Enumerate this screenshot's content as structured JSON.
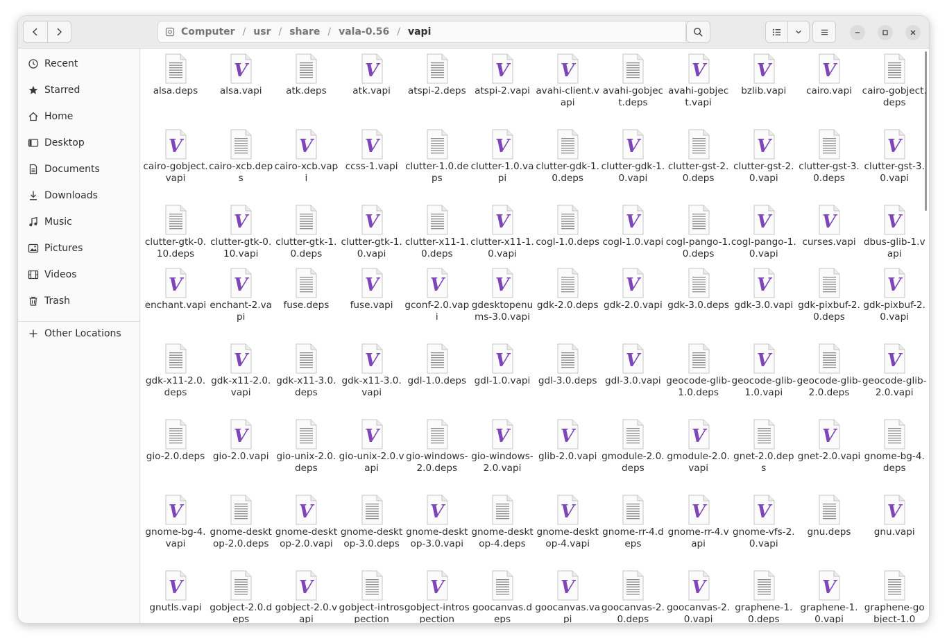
{
  "path": [
    "Computer",
    "usr",
    "share",
    "vala-0.56",
    "vapi"
  ],
  "sidebar": {
    "items": [
      {
        "label": "Recent",
        "icon": "clock-icon"
      },
      {
        "label": "Starred",
        "icon": "star-icon"
      },
      {
        "label": "Home",
        "icon": "home-icon"
      },
      {
        "label": "Desktop",
        "icon": "desktop-icon"
      },
      {
        "label": "Documents",
        "icon": "document-icon"
      },
      {
        "label": "Downloads",
        "icon": "download-icon"
      },
      {
        "label": "Music",
        "icon": "music-icon"
      },
      {
        "label": "Pictures",
        "icon": "picture-icon"
      },
      {
        "label": "Videos",
        "icon": "video-icon"
      },
      {
        "label": "Trash",
        "icon": "trash-icon"
      }
    ],
    "other_locations": "Other Locations"
  },
  "colors": {
    "vapi_accent": "#7e45b8",
    "doc_lines": "#8a8a8a"
  },
  "files": [
    {
      "name": "alsa.deps",
      "type": "deps"
    },
    {
      "name": "alsa.vapi",
      "type": "vapi"
    },
    {
      "name": "atk.deps",
      "type": "deps"
    },
    {
      "name": "atk.vapi",
      "type": "vapi"
    },
    {
      "name": "atspi-2.deps",
      "type": "deps"
    },
    {
      "name": "atspi-2.vapi",
      "type": "vapi"
    },
    {
      "name": "avahi-client.vapi",
      "type": "vapi"
    },
    {
      "name": "avahi-gobject.deps",
      "type": "deps"
    },
    {
      "name": "avahi-gobject.vapi",
      "type": "vapi"
    },
    {
      "name": "bzlib.vapi",
      "type": "vapi"
    },
    {
      "name": "cairo.vapi",
      "type": "vapi"
    },
    {
      "name": "cairo-gobject.deps",
      "type": "deps"
    },
    {
      "name": "cairo-gobject.vapi",
      "type": "vapi"
    },
    {
      "name": "cairo-xcb.deps",
      "type": "deps"
    },
    {
      "name": "cairo-xcb.vapi",
      "type": "vapi"
    },
    {
      "name": "ccss-1.vapi",
      "type": "vapi"
    },
    {
      "name": "clutter-1.0.deps",
      "type": "deps"
    },
    {
      "name": "clutter-1.0.vapi",
      "type": "vapi"
    },
    {
      "name": "clutter-gdk-1.0.deps",
      "type": "deps"
    },
    {
      "name": "clutter-gdk-1.0.vapi",
      "type": "vapi"
    },
    {
      "name": "clutter-gst-2.0.deps",
      "type": "deps"
    },
    {
      "name": "clutter-gst-2.0.vapi",
      "type": "vapi"
    },
    {
      "name": "clutter-gst-3.0.deps",
      "type": "deps"
    },
    {
      "name": "clutter-gst-3.0.vapi",
      "type": "vapi"
    },
    {
      "name": "clutter-gtk-0.10.deps",
      "type": "deps"
    },
    {
      "name": "clutter-gtk-0.10.vapi",
      "type": "vapi"
    },
    {
      "name": "clutter-gtk-1.0.deps",
      "type": "deps"
    },
    {
      "name": "clutter-gtk-1.0.vapi",
      "type": "vapi"
    },
    {
      "name": "clutter-x11-1.0.deps",
      "type": "deps"
    },
    {
      "name": "clutter-x11-1.0.vapi",
      "type": "vapi"
    },
    {
      "name": "cogl-1.0.deps",
      "type": "deps"
    },
    {
      "name": "cogl-1.0.vapi",
      "type": "vapi"
    },
    {
      "name": "cogl-pango-1.0.deps",
      "type": "deps"
    },
    {
      "name": "cogl-pango-1.0.vapi",
      "type": "vapi"
    },
    {
      "name": "curses.vapi",
      "type": "vapi"
    },
    {
      "name": "dbus-glib-1.vapi",
      "type": "vapi"
    },
    {
      "name": "enchant.vapi",
      "type": "vapi"
    },
    {
      "name": "enchant-2.vapi",
      "type": "vapi"
    },
    {
      "name": "fuse.deps",
      "type": "deps"
    },
    {
      "name": "fuse.vapi",
      "type": "vapi"
    },
    {
      "name": "gconf-2.0.vapi",
      "type": "vapi"
    },
    {
      "name": "gdesktopenums-3.0.vapi",
      "type": "vapi"
    },
    {
      "name": "gdk-2.0.deps",
      "type": "deps"
    },
    {
      "name": "gdk-2.0.vapi",
      "type": "vapi"
    },
    {
      "name": "gdk-3.0.deps",
      "type": "deps"
    },
    {
      "name": "gdk-3.0.vapi",
      "type": "vapi"
    },
    {
      "name": "gdk-pixbuf-2.0.deps",
      "type": "deps"
    },
    {
      "name": "gdk-pixbuf-2.0.vapi",
      "type": "vapi"
    },
    {
      "name": "gdk-x11-2.0.deps",
      "type": "deps"
    },
    {
      "name": "gdk-x11-2.0.vapi",
      "type": "vapi"
    },
    {
      "name": "gdk-x11-3.0.deps",
      "type": "deps"
    },
    {
      "name": "gdk-x11-3.0.vapi",
      "type": "vapi"
    },
    {
      "name": "gdl-1.0.deps",
      "type": "deps"
    },
    {
      "name": "gdl-1.0.vapi",
      "type": "vapi"
    },
    {
      "name": "gdl-3.0.deps",
      "type": "deps"
    },
    {
      "name": "gdl-3.0.vapi",
      "type": "vapi"
    },
    {
      "name": "geocode-glib-1.0.deps",
      "type": "deps"
    },
    {
      "name": "geocode-glib-1.0.vapi",
      "type": "vapi"
    },
    {
      "name": "geocode-glib-2.0.deps",
      "type": "deps"
    },
    {
      "name": "geocode-glib-2.0.vapi",
      "type": "vapi"
    },
    {
      "name": "gio-2.0.deps",
      "type": "deps"
    },
    {
      "name": "gio-2.0.vapi",
      "type": "vapi"
    },
    {
      "name": "gio-unix-2.0.deps",
      "type": "deps"
    },
    {
      "name": "gio-unix-2.0.vapi",
      "type": "vapi"
    },
    {
      "name": "gio-windows-2.0.deps",
      "type": "deps"
    },
    {
      "name": "gio-windows-2.0.vapi",
      "type": "vapi"
    },
    {
      "name": "glib-2.0.vapi",
      "type": "vapi"
    },
    {
      "name": "gmodule-2.0.deps",
      "type": "deps"
    },
    {
      "name": "gmodule-2.0.vapi",
      "type": "vapi"
    },
    {
      "name": "gnet-2.0.deps",
      "type": "deps"
    },
    {
      "name": "gnet-2.0.vapi",
      "type": "vapi"
    },
    {
      "name": "gnome-bg-4.deps",
      "type": "deps"
    },
    {
      "name": "gnome-bg-4.vapi",
      "type": "vapi"
    },
    {
      "name": "gnome-desktop-2.0.deps",
      "type": "deps"
    },
    {
      "name": "gnome-desktop-2.0.vapi",
      "type": "vapi"
    },
    {
      "name": "gnome-desktop-3.0.deps",
      "type": "deps"
    },
    {
      "name": "gnome-desktop-3.0.vapi",
      "type": "vapi"
    },
    {
      "name": "gnome-desktop-4.deps",
      "type": "deps"
    },
    {
      "name": "gnome-desktop-4.vapi",
      "type": "vapi"
    },
    {
      "name": "gnome-rr-4.deps",
      "type": "deps"
    },
    {
      "name": "gnome-rr-4.vapi",
      "type": "vapi"
    },
    {
      "name": "gnome-vfs-2.0.vapi",
      "type": "vapi"
    },
    {
      "name": "gnu.deps",
      "type": "deps"
    },
    {
      "name": "gnu.vapi",
      "type": "vapi"
    },
    {
      "name": "gnutls.vapi",
      "type": "vapi"
    },
    {
      "name": "gobject-2.0.deps",
      "type": "deps"
    },
    {
      "name": "gobject-2.0.vapi",
      "type": "vapi"
    },
    {
      "name": "gobject-introspection",
      "type": "deps"
    },
    {
      "name": "gobject-introspection",
      "type": "vapi"
    },
    {
      "name": "goocanvas.deps",
      "type": "deps"
    },
    {
      "name": "goocanvas.vapi",
      "type": "vapi"
    },
    {
      "name": "goocanvas-2.0.deps",
      "type": "deps"
    },
    {
      "name": "goocanvas-2.0.vapi",
      "type": "vapi"
    },
    {
      "name": "graphene-1.0.deps",
      "type": "deps"
    },
    {
      "name": "graphene-1.0.vapi",
      "type": "vapi"
    },
    {
      "name": "graphene-gobject-1.0",
      "type": "deps"
    }
  ]
}
